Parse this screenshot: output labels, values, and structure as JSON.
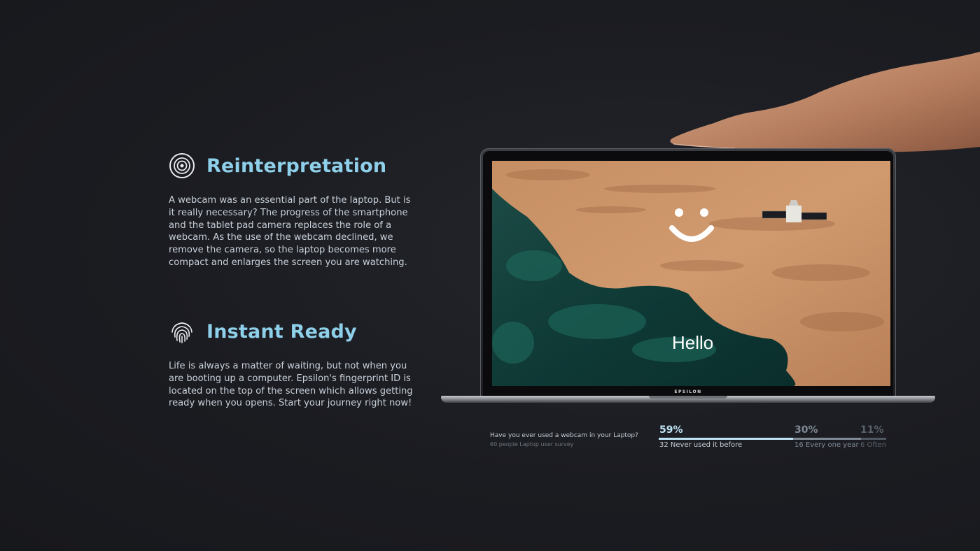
{
  "sections": [
    {
      "icon": "camera-lens-icon",
      "title": "Reinterpretation",
      "body": "A webcam was an essential part of the laptop. But is it really necessary? The progress of the smartphone and the tablet pad camera replaces the role of a webcam. As the use of the webcam declined, we remove the camera, so the laptop becomes more compact and enlarges the screen you are watching."
    },
    {
      "icon": "fingerprint-icon",
      "title": "Instant Ready",
      "body": "Life is always a matter of waiting, but not when you are booting up a computer. Epsilon's fingerprint ID is located on the top of the screen which allows getting ready when you opens. Start your journey right now!"
    }
  ],
  "laptop": {
    "brand": "EPSILON",
    "greeting": "Hello",
    "screen_icons": [
      "smiley-icon",
      "satellite-icon"
    ]
  },
  "survey": {
    "question": "Have you ever used a webcam in your Laptop?",
    "subtitle": "60 people Laptop user survey",
    "results": [
      {
        "percent": "59%",
        "label": "32 Never used it before",
        "share": 0.59,
        "color": "#bfe3f3"
      },
      {
        "percent": "30%",
        "label": "16 Every one year",
        "share": 0.3,
        "color": "#7f8a96"
      },
      {
        "percent": "11%",
        "label": "6 Often",
        "share": 0.11,
        "color": "#4f5761"
      }
    ]
  },
  "colors": {
    "accent": "#8ecfe9",
    "background": "#1b1c21"
  }
}
